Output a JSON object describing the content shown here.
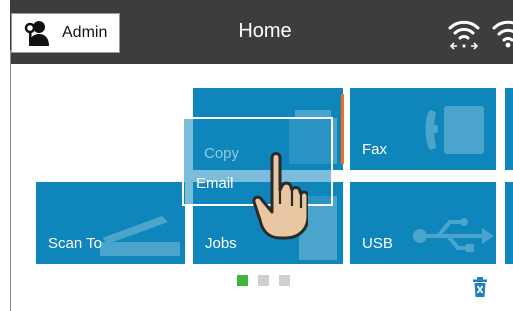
{
  "header": {
    "admin_label": "Admin",
    "title": "Home"
  },
  "tiles": {
    "copy": "Copy",
    "fax": "Fax",
    "email": "Email",
    "scan_to": "Scan To",
    "jobs": "Jobs",
    "usb": "USB"
  },
  "pager": {
    "pages": 3,
    "current": 1
  },
  "colors": {
    "header_bg": "#3d3d3d",
    "tile_bg": "#0e86bb",
    "accent_orange": "#f07020",
    "pager_active": "#3fb53a",
    "trash_icon": "#1e7fc4"
  },
  "icons": [
    "admin-icon",
    "wifi-icon",
    "wifi-direct-icon",
    "hand-pointer-icon",
    "trash-icon",
    "fax-icon",
    "scanner-icon",
    "usb-icon"
  ]
}
